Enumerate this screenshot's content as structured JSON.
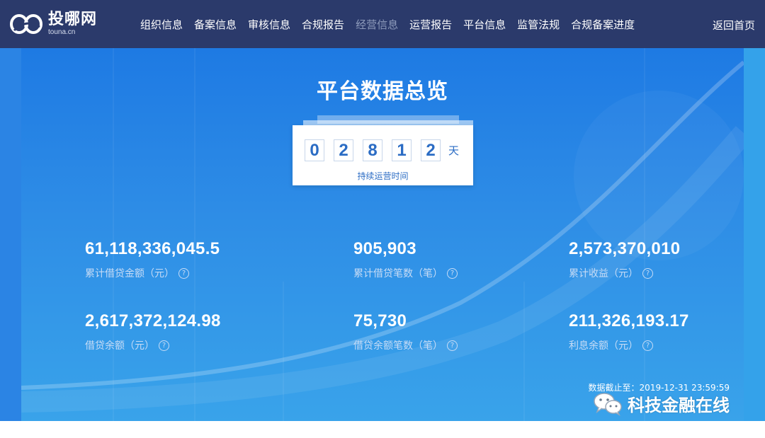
{
  "brand": {
    "name": "投哪网",
    "domain": "touna.cn"
  },
  "nav": {
    "items": [
      {
        "label": "组织信息",
        "active": false
      },
      {
        "label": "备案信息",
        "active": false
      },
      {
        "label": "审核信息",
        "active": false
      },
      {
        "label": "合规报告",
        "active": false
      },
      {
        "label": "经营信息",
        "active": true
      },
      {
        "label": "运营报告",
        "active": false
      },
      {
        "label": "平台信息",
        "active": false
      },
      {
        "label": "监管法规",
        "active": false
      },
      {
        "label": "合规备案进度",
        "active": false
      }
    ],
    "home": "返回首页"
  },
  "overview": {
    "title": "平台数据总览",
    "days_digits": [
      "0",
      "2",
      "8",
      "1",
      "2"
    ],
    "day_unit": "天",
    "days_label": "持续运营时间"
  },
  "stats": [
    {
      "value": "61,118,336,045.5",
      "label": "累计借贷金额（元）"
    },
    {
      "value": "905,903",
      "label": "累计借贷笔数（笔）"
    },
    {
      "value": "2,573,370,010",
      "label": "累计收益（元）"
    },
    {
      "value": "2,617,372,124.98",
      "label": "借贷余额（元）"
    },
    {
      "value": "75,730",
      "label": "借贷余额笔数（笔）"
    },
    {
      "value": "211,326,193.17",
      "label": "利息余额（元）"
    }
  ],
  "help_glyph": "?",
  "cutoff": "数据截止至：2019-12-31 23:59:59",
  "watermark": "科技金融在线",
  "colors": {
    "nav_bg": "#2b3a6b",
    "hero_top": "#1e7ae3",
    "hero_bottom": "#39a3ea",
    "digit": "#2b6cc4",
    "nav_dim": "#8e9bbb"
  }
}
